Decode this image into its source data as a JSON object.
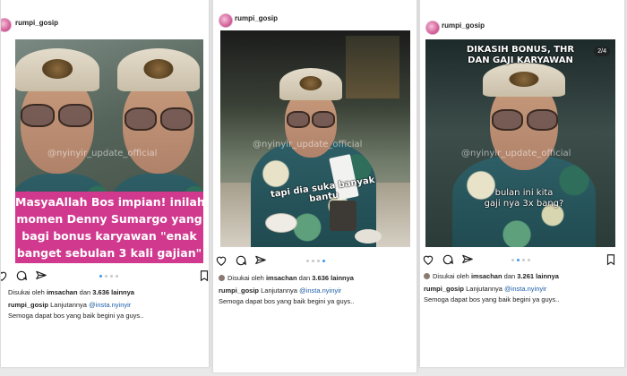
{
  "posts": [
    {
      "username": "rumpi_gosip",
      "watermark": "@nyinyir_update_official",
      "overlay_lines": [
        "MasyaAllah Bos impian! inilah",
        "momen Denny Sumargo yang",
        "bagi bonus karyawan \"enak",
        "banget sebulan 3 kali gajian\""
      ],
      "liked_prefix": "Disukai oleh",
      "liked_by": "imsachan",
      "liked_and": "dan",
      "liked_count": "3.636 lainnya",
      "caption_user": "rumpi_gosip",
      "caption_mid": "Lanjutannya",
      "caption_link": "@insta.nyinyir",
      "caption_line2": "Semoga dapat bos yang baik begini ya guys.."
    },
    {
      "username": "rumpi_gosip",
      "watermark": "@nyinyir_update_official",
      "subtitle": "tapi dia suka banyak bantu",
      "liked_prefix": "Disukai oleh",
      "liked_by": "imsachan",
      "liked_and": "dan",
      "liked_count": "3.636 lainnya",
      "caption_user": "rumpi_gosip",
      "caption_mid": "Lanjutannya",
      "caption_link": "@insta.nyinyir",
      "caption_line2": "Semoga dapat bos yang baik begini ya guys.."
    },
    {
      "username": "rumpi_gosip",
      "watermark": "@nyinyir_update_official",
      "top_caption_1": "DIKASIH BONUS, THR",
      "top_caption_2": "DAN GAJI KARYAWAN",
      "subtitle_1": "bulan ini kita",
      "subtitle_2": "gaji nya 3x bang?",
      "counter": "2/4",
      "liked_prefix": "Disukai oleh",
      "liked_by": "imsachan",
      "liked_and": "dan",
      "liked_count": "3.261 lainnya",
      "caption_user": "rumpi_gosip",
      "caption_mid": "Lanjutannya",
      "caption_link": "@insta.nyinyir",
      "caption_line2": "Semoga dapat bos yang baik begini ya guys.."
    }
  ],
  "colors": {
    "pink_banner": "#d1398f",
    "active_dot": "#3897f0",
    "link": "#1f5fa8"
  },
  "icons": [
    "heart-icon",
    "comment-icon",
    "share-icon",
    "bookmark-icon"
  ]
}
